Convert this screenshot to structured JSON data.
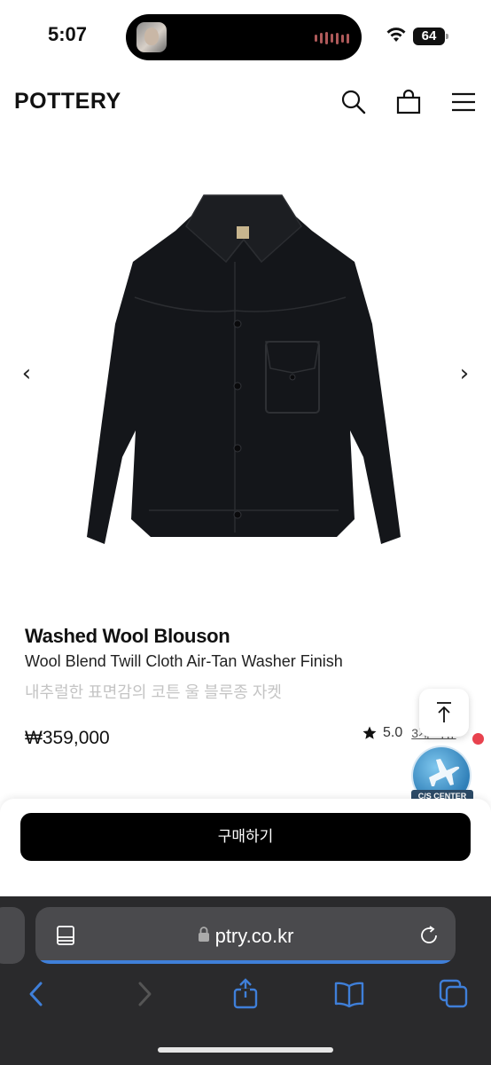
{
  "status_bar": {
    "time": "5:07",
    "battery": "64"
  },
  "header": {
    "logo": "POTTERY",
    "icons": [
      "search-icon",
      "bag-icon",
      "menu-icon"
    ]
  },
  "carousel": {
    "prev_arrow": "‹",
    "next_arrow": "›"
  },
  "product": {
    "name": "Washed Wool Blouson",
    "description": "Wool Blend Twill Cloth Air-Tan Washer Finish",
    "description_ko": "내추럴한 표면감의 코튼 울 블루종 자켓",
    "price": "₩359,000",
    "rating": "5.0",
    "review_link": "3개 리뷰"
  },
  "floating": {
    "cs_label": "C/S CENTER"
  },
  "buy": {
    "button_label": "구매하기"
  },
  "browser": {
    "url": "ptry.co.kr"
  },
  "colors": {
    "accent_blue": "#3f7fd9",
    "notification_red": "#e8424e",
    "buy_button": "#000000"
  }
}
